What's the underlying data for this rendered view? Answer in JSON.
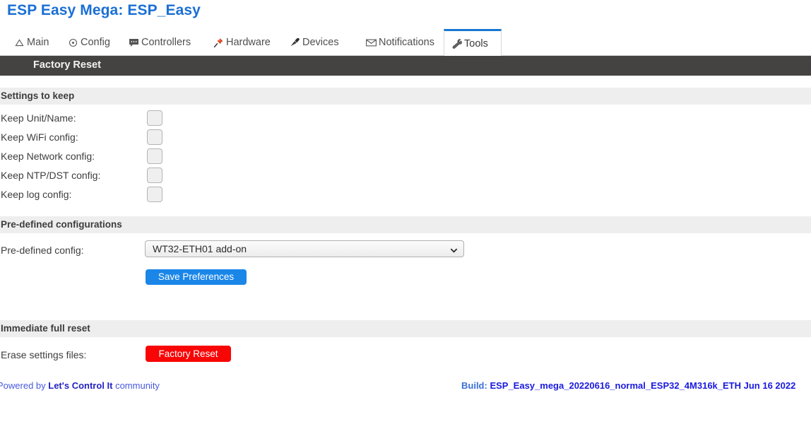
{
  "app": {
    "title": "ESP Easy Mega: ESP_Easy"
  },
  "tabs": [
    {
      "label": "Main",
      "icon": "home-icon",
      "active": false
    },
    {
      "label": "Config",
      "icon": "gear-icon",
      "active": false
    },
    {
      "label": "Controllers",
      "icon": "speech-bubble-icon",
      "active": false
    },
    {
      "label": "Hardware",
      "icon": "pushpin-icon",
      "active": false
    },
    {
      "label": "Devices",
      "icon": "plug-icon",
      "active": false
    },
    {
      "label": "Notifications",
      "icon": "envelope-icon",
      "active": false
    },
    {
      "label": "Tools",
      "icon": "wrench-icon",
      "active": true
    }
  ],
  "subheader": {
    "title": "Factory Reset"
  },
  "sections": {
    "settings_to_keep": {
      "title": "Settings to keep",
      "rows": [
        {
          "label": "Keep Unit/Name:",
          "checked": false
        },
        {
          "label": "Keep WiFi config:",
          "checked": false
        },
        {
          "label": "Keep Network config:",
          "checked": false
        },
        {
          "label": "Keep NTP/DST config:",
          "checked": false
        },
        {
          "label": "Keep log config:",
          "checked": false
        }
      ]
    },
    "predefined": {
      "title": "Pre-defined configurations",
      "label": "Pre-defined config:",
      "selected": "WT32-ETH01 add-on",
      "save_label": "Save Preferences"
    },
    "immediate_reset": {
      "title": "Immediate full reset",
      "label": "Erase settings files:",
      "button_label": "Factory Reset"
    }
  },
  "footer": {
    "powered_prefix": "Powered by ",
    "powered_brand": "Let's Control It",
    "powered_suffix": " community",
    "build_label": "Build: ",
    "build_value": "ESP_Easy_mega_20220616_normal_ESP32_4M316k_ETH Jun 16 2022"
  },
  "colors": {
    "title_blue": "#1a6fd4",
    "tab_active_border": "#1878d2",
    "subheader_bg": "#454341",
    "section_bg": "#eeeeee",
    "save_button": "#1a86e8",
    "reset_button": "#f80606",
    "footer_link": "#2323c0",
    "build_text": "#1a1ae0"
  }
}
